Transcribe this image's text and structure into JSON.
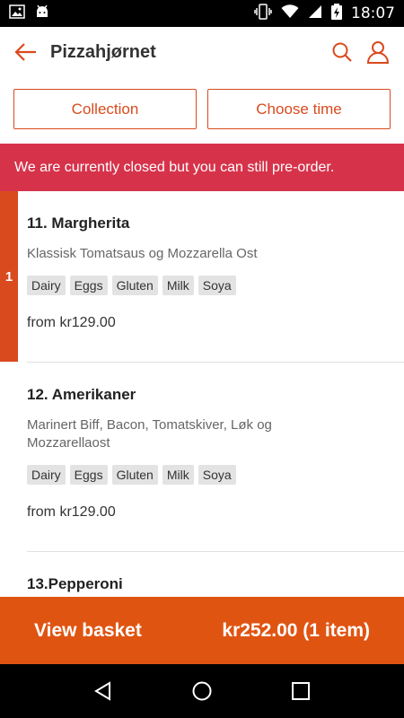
{
  "status_bar": {
    "time": "18:07"
  },
  "app_bar": {
    "title": "Pizzahjørnet"
  },
  "order_options": {
    "collection_label": "Collection",
    "choose_time_label": "Choose time"
  },
  "banner": {
    "text": "We are currently closed but you can still pre-order."
  },
  "menu_items": [
    {
      "name": "11. Margherita",
      "description": "Klassisk Tomatsaus og Mozzarella Ost",
      "tags": [
        "Dairy",
        "Eggs",
        "Gluten",
        "Milk",
        "Soya"
      ],
      "price": "from kr129.00",
      "quantity": "1"
    },
    {
      "name": "12. Amerikaner",
      "description": "Marinert Biff, Bacon, Tomatskiver, Løk og Mozzarellaost",
      "tags": [
        "Dairy",
        "Eggs",
        "Gluten",
        "Milk",
        "Soya"
      ],
      "price": "from kr129.00"
    },
    {
      "name": "13.Pepperoni"
    }
  ],
  "basket": {
    "label": "View basket",
    "summary": "kr252.00 (1 item)"
  },
  "colors": {
    "accent": "#d94a1e",
    "banner": "#d6334b",
    "basket": "#e05412"
  }
}
